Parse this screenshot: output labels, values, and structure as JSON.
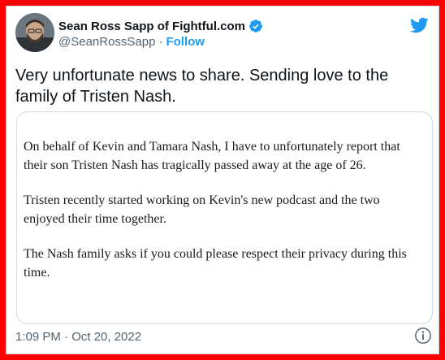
{
  "author": {
    "display_name": "Sean Ross Sapp of Fightful.com",
    "handle": "@SeanRossSapp",
    "separator": "·",
    "follow_label": "Follow",
    "verified": true
  },
  "tweet": {
    "text": "Very unfortunate news to share. Sending love to the family of Tristen Nash."
  },
  "media": {
    "paragraphs": [
      "On behalf of Kevin and Tamara Nash, I have to unfortunately report that their son Tristen Nash has tragically passed away at the age of 26.",
      "Tristen recently started working on Kevin's new podcast and the two enjoyed their time together.",
      "The Nash family asks if you could please respect their privacy during this time."
    ]
  },
  "footer": {
    "timestamp": "1:09 PM · Oct 20, 2022"
  },
  "icons": {
    "brand": "twitter-bird-icon",
    "verified": "verified-badge-icon",
    "info": "info-icon"
  },
  "colors": {
    "accent": "#1d9bf0",
    "frame_border": "#ff0000",
    "text_primary": "#0f1419",
    "text_secondary": "#536471"
  }
}
